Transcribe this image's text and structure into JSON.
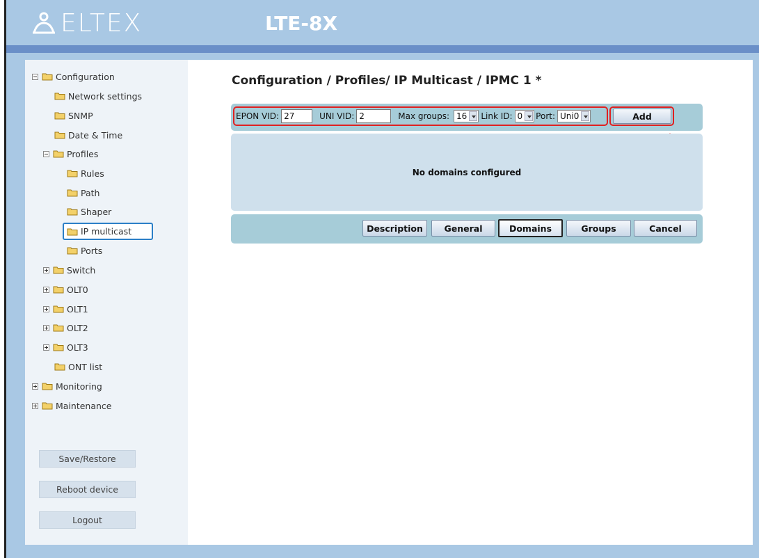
{
  "header": {
    "logo_text": "ELTEX",
    "device": "LTE-8X"
  },
  "tree": {
    "configuration": "Configuration",
    "network_settings": "Network settings",
    "snmp": "SNMP",
    "date_time": "Date & Time",
    "profiles": "Profiles",
    "rules": "Rules",
    "path": "Path",
    "shaper": "Shaper",
    "ip_multicast": "IP multicast",
    "ports": "Ports",
    "switch": "Switch",
    "olt0": "OLT0",
    "olt1": "OLT1",
    "olt2": "OLT2",
    "olt3": "OLT3",
    "ont_list": "ONT list",
    "monitoring": "Monitoring",
    "maintenance": "Maintenance"
  },
  "side_buttons": {
    "save_restore": "Save/Restore",
    "reboot": "Reboot device",
    "logout": "Logout"
  },
  "page_title": "Configuration / Profiles/ IP Multicast / IPMC 1 *",
  "form": {
    "epon_vid_label": "EPON VID:",
    "epon_vid_value": "27",
    "uni_vid_label": "UNI VID:",
    "uni_vid_value": "2",
    "max_groups_label": "Max groups:",
    "max_groups_value": "16",
    "link_id_label": "Link ID:",
    "link_id_value": "0",
    "port_label": "Port:",
    "port_value": "Uni0",
    "add_label": "Add"
  },
  "empty_message": "No domains configured",
  "tabs": {
    "description": "Description",
    "general": "General",
    "domains": "Domains",
    "groups": "Groups",
    "cancel": "Cancel"
  },
  "colors": {
    "header_bg": "#a9c8e4",
    "header_strip": "#6a8fc8",
    "bar_bg": "#a6ccd8",
    "panel_bg": "#cfe0ec",
    "highlight": "#e02020",
    "selection": "#2b7fc7"
  }
}
